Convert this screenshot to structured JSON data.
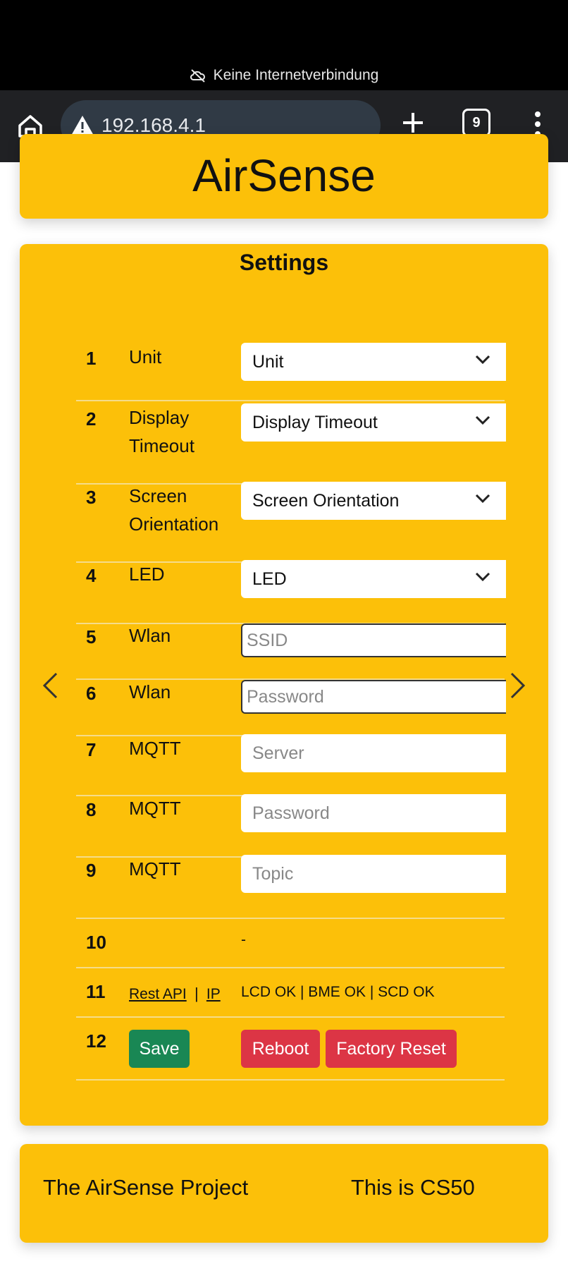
{
  "statusbar": {
    "network_text": "Keine Internetverbindung",
    "network_icon": "cloud-off-icon"
  },
  "browser": {
    "url": "192.168.4.1",
    "tab_count": "9",
    "home_icon": "home-icon",
    "warning_icon": "warning-icon",
    "new_tab_icon": "plus-icon",
    "menu_icon": "more-vert-icon"
  },
  "header": {
    "brand": "AirSense"
  },
  "settings": {
    "title": "Settings",
    "rows": [
      {
        "num": "1",
        "label": "Unit",
        "select": "Unit"
      },
      {
        "num": "2",
        "label": "Display Timeout",
        "select": "Display Timeout"
      },
      {
        "num": "3",
        "label": "Screen Orientation",
        "select": "Screen Orientation"
      },
      {
        "num": "4",
        "label": "LED",
        "select": "LED"
      },
      {
        "num": "5",
        "label": "Wlan",
        "placeholder": "SSID"
      },
      {
        "num": "6",
        "label": "Wlan",
        "placeholder": "Password"
      },
      {
        "num": "7",
        "label": "MQTT",
        "placeholder": "Server"
      },
      {
        "num": "8",
        "label": "MQTT",
        "placeholder": "Password"
      },
      {
        "num": "9",
        "label": "MQTT",
        "placeholder": "Topic"
      },
      {
        "num": "10",
        "label": "",
        "value": "-"
      },
      {
        "num": "11",
        "link1": "Rest API",
        "separator": "|",
        "link2": "IP",
        "status": "LCD OK | BME OK | SCD OK"
      },
      {
        "num": "12",
        "save": "Save",
        "reboot": "Reboot",
        "factory_reset": "Factory Reset"
      }
    ]
  },
  "footer": {
    "left": "The AirSense Project",
    "right": "This is CS50"
  },
  "colors": {
    "card": "#fcc009",
    "save": "#198754",
    "danger": "#dc3545"
  }
}
